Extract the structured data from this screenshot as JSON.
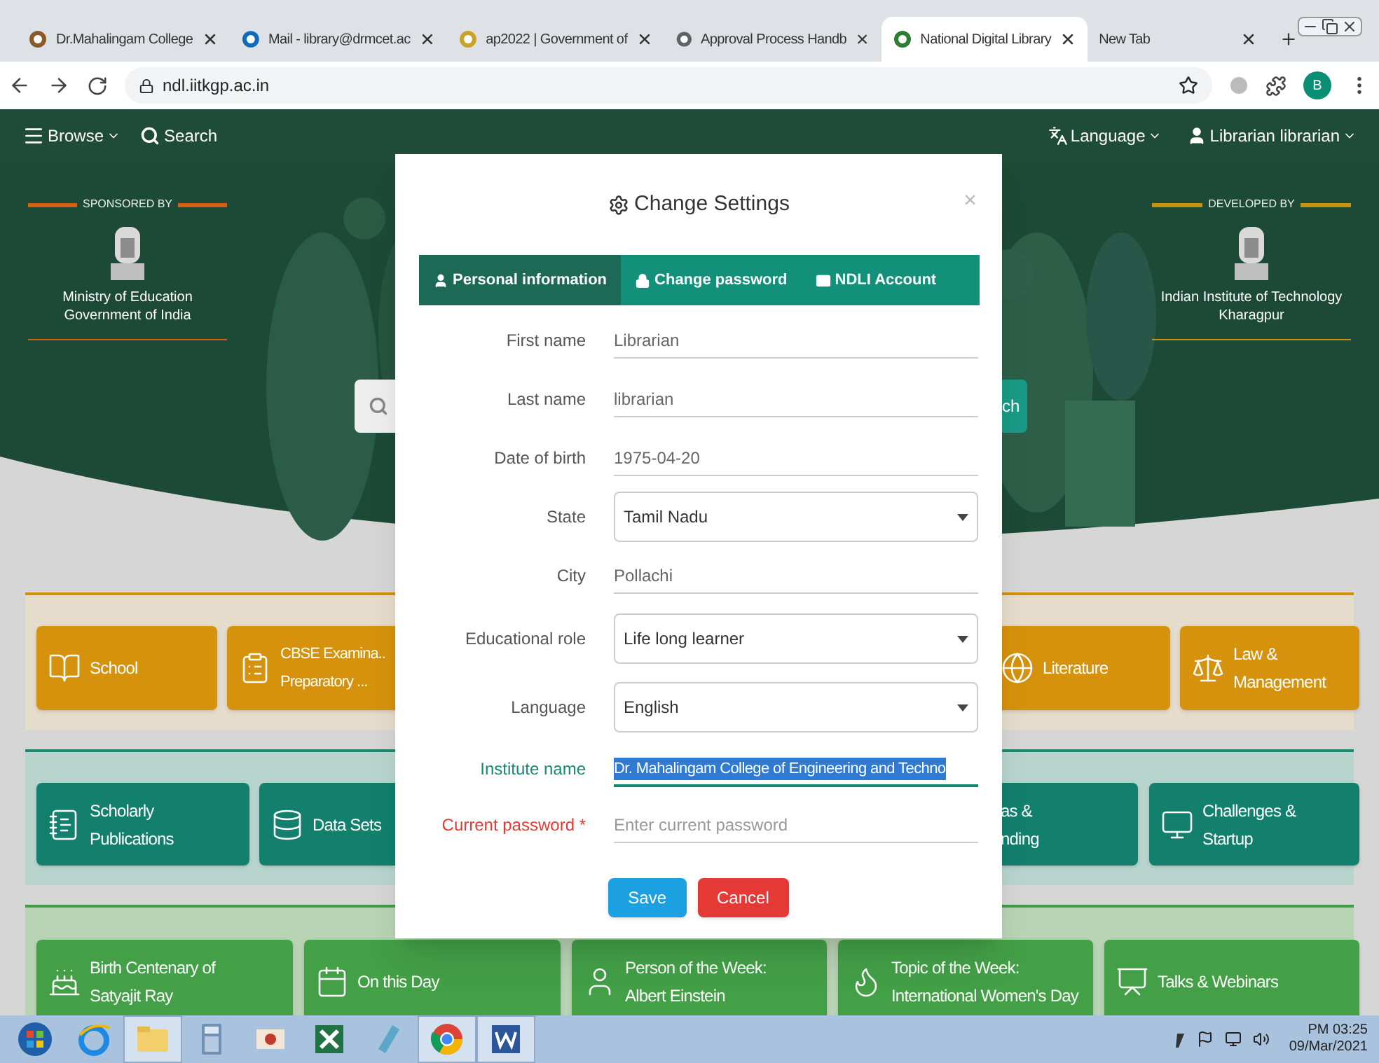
{
  "browser": {
    "tabs": [
      {
        "title": "Dr.Mahalingam College",
        "selected": false
      },
      {
        "title": "Mail - library@drmcet.ac",
        "selected": false
      },
      {
        "title": "ap2022 | Government of",
        "selected": false
      },
      {
        "title": "Approval Process Handb",
        "selected": false
      },
      {
        "title": "National Digital Library",
        "selected": true
      },
      {
        "title": "New Tab",
        "selected": false
      }
    ],
    "address": "ndl.iitkgp.ac.in",
    "profile": "B"
  },
  "nav": {
    "browse": "Browse",
    "search": "Search",
    "language": "Language",
    "user": "Librarian librarian"
  },
  "hero": {
    "sponsor": {
      "heading": "SPONSORED BY",
      "lines": [
        "Ministry of Education",
        "Government of India"
      ]
    },
    "developer": {
      "heading": "DEVELOPED BY",
      "lines": [
        "Indian Institute of Technology",
        "Kharagpur"
      ]
    },
    "search_button": "ch"
  },
  "sections": [
    {
      "kind": "orange",
      "tiles": [
        {
          "lines": [
            "School"
          ]
        },
        {
          "lines": [
            "CBSE Examina..",
            "Preparatory ..."
          ]
        },
        {
          "lines": [
            "Literature"
          ]
        },
        {
          "lines": [
            "Law &",
            "Management"
          ]
        }
      ]
    },
    {
      "kind": "teal",
      "tiles": [
        {
          "lines": [
            "Scholarly",
            "Publications"
          ]
        },
        {
          "lines": [
            "Data Sets"
          ]
        },
        {
          "lines": [
            "as &",
            "nding"
          ]
        },
        {
          "lines": [
            "Challenges &",
            "Startup"
          ]
        }
      ]
    },
    {
      "kind": "green",
      "tiles": [
        {
          "lines": [
            "Birth Centenary of",
            "Satyajit Ray"
          ]
        },
        {
          "lines": [
            "On this Day"
          ]
        },
        {
          "lines": [
            "Person of the Week:",
            "Albert Einstein"
          ]
        },
        {
          "lines": [
            "Topic of the Week:",
            "International Women's Day"
          ]
        },
        {
          "lines": [
            "Talks & Webinars"
          ]
        }
      ]
    }
  ],
  "modal": {
    "title": "Change Settings",
    "close": "×",
    "tabs": [
      {
        "label": "Personal information",
        "selected": true
      },
      {
        "label": "Change password",
        "selected": false
      },
      {
        "label": "NDLI Account",
        "selected": false
      }
    ],
    "fields": [
      {
        "label": "First name",
        "kind": "text",
        "value": "Librarian",
        "focused": false,
        "required": false,
        "highlighted": false
      },
      {
        "label": "Last name",
        "kind": "text",
        "value": "librarian",
        "focused": false,
        "required": false,
        "highlighted": false
      },
      {
        "label": "Date of birth",
        "kind": "text",
        "value": "1975-04-20",
        "focused": false,
        "required": false,
        "highlighted": false
      },
      {
        "label": "State",
        "kind": "select",
        "value": "Tamil Nadu",
        "focused": false,
        "required": false,
        "highlighted": false
      },
      {
        "label": "City",
        "kind": "text",
        "value": "Pollachi",
        "focused": false,
        "required": false,
        "highlighted": false
      },
      {
        "label": "Educational role",
        "kind": "select",
        "value": "Life long learner",
        "focused": false,
        "required": false,
        "highlighted": false
      },
      {
        "label": "Language",
        "kind": "select",
        "value": "English",
        "focused": false,
        "required": false,
        "highlighted": false
      },
      {
        "label": "Institute name",
        "kind": "text",
        "value": "Dr. Mahalingam College of Engineering and Techno",
        "focused": true,
        "required": false,
        "highlighted": true
      },
      {
        "label": "Current password *",
        "kind": "text",
        "placeholder": "Enter current password",
        "focused": false,
        "required": true,
        "highlighted": false
      }
    ],
    "buttons": [
      {
        "label": "Save",
        "kind": "primary"
      },
      {
        "label": "Cancel",
        "kind": "danger"
      }
    ]
  },
  "taskbar": {
    "apps": [
      {
        "active": false
      },
      {
        "active": false
      },
      {
        "active": true
      },
      {
        "active": false
      },
      {
        "active": false
      },
      {
        "active": false
      },
      {
        "active": false
      },
      {
        "active": true
      },
      {
        "active": true
      }
    ],
    "time": "PM 03:25",
    "date": "09/Mar/2021"
  }
}
